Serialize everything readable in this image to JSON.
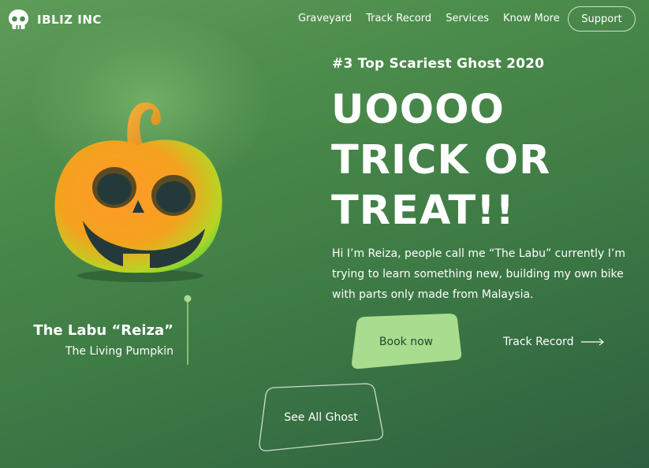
{
  "brand": {
    "name": "IBLIZ INC",
    "logo_icon": "skull-icon"
  },
  "nav": {
    "links": [
      "Graveyard",
      "Track Record",
      "Services",
      "Know More"
    ],
    "support_label": "Support"
  },
  "hero": {
    "kicker": "#3 Top Scariest Ghost 2020",
    "headline": [
      "UOOOO",
      "TRICK OR",
      "TREAT!!"
    ],
    "description": "Hi I’m Reiza, people call me “The Labu” currently I’m trying to learn something new, building my own bike with parts only made from Malaysia.",
    "cta_primary": "Book now",
    "cta_secondary": "Track Record",
    "cta_secondary_icon": "arrow-right-icon",
    "cta_outline": "See All Ghost"
  },
  "character": {
    "name": "The Labu “Reiza”",
    "role": "The Living Pumpkin",
    "illustration": "pumpkin-icon"
  },
  "colors": {
    "background": "#4a8a4a",
    "accent_button": "#a8dc8e",
    "accent_button_text": "#1f4a2a"
  }
}
